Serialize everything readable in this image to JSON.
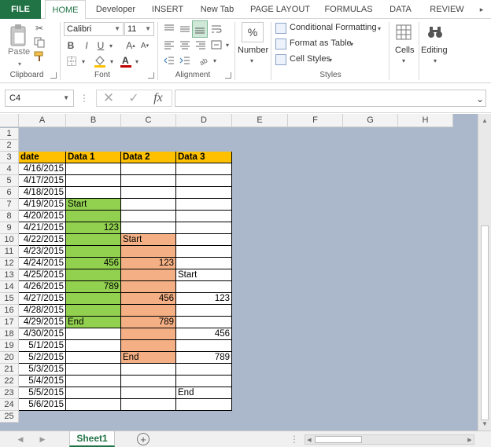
{
  "ribbon": {
    "tabs": [
      "FILE",
      "HOME",
      "Developer",
      "INSERT",
      "New Tab",
      "PAGE LAYOUT",
      "FORMULAS",
      "DATA",
      "REVIEW"
    ],
    "active_tab": "HOME",
    "clipboard": {
      "label": "Clipboard",
      "paste": "Paste"
    },
    "font": {
      "label": "Font",
      "name": "Calibri",
      "size": "11",
      "bold": "B",
      "italic": "I",
      "underline": "U"
    },
    "alignment": {
      "label": "Alignment"
    },
    "number": {
      "label": "Number",
      "icon_text": "%"
    },
    "styles": {
      "label": "Styles",
      "conditional": "Conditional Formatting",
      "table": "Format as Table",
      "cell_styles": "Cell Styles"
    },
    "cells": {
      "label": "Cells"
    },
    "editing": {
      "label": "Editing"
    }
  },
  "formula_bar": {
    "name_box": "C4",
    "fx": "fx",
    "formula": ""
  },
  "grid": {
    "columns": [
      "A",
      "B",
      "C",
      "D",
      "E",
      "F",
      "G",
      "H"
    ],
    "rows": [
      "1",
      "2",
      "3",
      "4",
      "5",
      "6",
      "7",
      "8",
      "9",
      "10",
      "11",
      "12",
      "13",
      "14",
      "15",
      "16",
      "17",
      "18",
      "19",
      "20",
      "21",
      "22",
      "23",
      "24",
      "25"
    ],
    "header": [
      "date",
      "Data 1",
      "Data 2",
      "Data 3"
    ],
    "dates": [
      "4/16/2015",
      "4/17/2015",
      "4/18/2015",
      "4/19/2015",
      "4/20/2015",
      "4/21/2015",
      "4/22/2015",
      "4/23/2015",
      "4/24/2015",
      "4/25/2015",
      "4/26/2015",
      "4/27/2015",
      "4/28/2015",
      "4/29/2015",
      "4/30/2015",
      "5/1/2015",
      "5/2/2015",
      "5/3/2015",
      "5/4/2015",
      "5/5/2015",
      "5/6/2015"
    ],
    "data1": [
      "",
      "",
      "",
      "Start",
      "",
      "123",
      "",
      "",
      "456",
      "",
      "789",
      "",
      "",
      "End",
      "",
      "",
      "",
      "",
      "",
      "",
      ""
    ],
    "data2": [
      "",
      "",
      "",
      "",
      "",
      "",
      "Start",
      "",
      "123",
      "",
      "",
      "456",
      "",
      "789",
      "",
      "",
      "End",
      "",
      "",
      "",
      ""
    ],
    "data3": [
      "",
      "",
      "",
      "",
      "",
      "",
      "",
      "",
      "",
      "Start",
      "",
      "123",
      "",
      "",
      "456",
      "",
      "789",
      "",
      "",
      "End",
      ""
    ],
    "colors": {
      "header_fill": "#ffc000",
      "data1_fill": "#92d050",
      "data2_fill": "#f4b084",
      "background": "#abb8cb"
    }
  },
  "sheets": {
    "tabs": [
      "Sheet1"
    ],
    "active": "Sheet1"
  }
}
